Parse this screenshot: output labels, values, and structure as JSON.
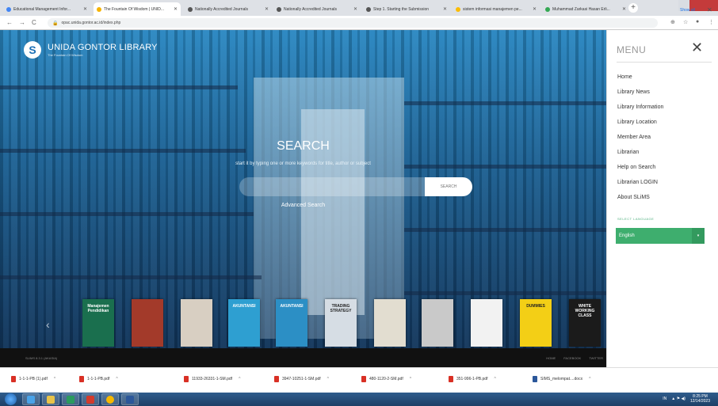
{
  "browser": {
    "tabs": [
      {
        "title": "Educational Management Infor...",
        "fav": "#4285f4"
      },
      {
        "title": "The Fountain Of Wisdom | UNID...",
        "fav": "#f6b300",
        "active": true
      },
      {
        "title": "Nationally Accredited Journals",
        "fav": "#555"
      },
      {
        "title": "Nationally Accredited Journals",
        "fav": "#555"
      },
      {
        "title": "Step 1. Starting the Submission",
        "fav": "#555"
      },
      {
        "title": "sistem informasi manajemen pe...",
        "fav": "#fbbc05"
      },
      {
        "title": "Muhammad Zarkasi Hasan Erli...",
        "fav": "#34a853"
      }
    ],
    "url": "opac.unida.gontor.ac.id/index.php"
  },
  "site": {
    "name": "UNIDA GONTOR LIBRARY",
    "tagline": "The Fountain Of Wisdom",
    "search_title": "SEARCH",
    "search_hint": "start it by typing one or more keywords for title, author or subject",
    "search_placeholder": "",
    "search_button": "SEARCH",
    "advanced_search": "Advanced Search",
    "footer_left": "SLIMS 8.3.1 (AKASIA)",
    "footer_links": [
      "HOME",
      "FACEBOOK",
      "TWITTER"
    ]
  },
  "books": [
    {
      "label": "Manajemen Pendidikan",
      "color": "#1a6f4e"
    },
    {
      "label": "",
      "color": "#a33a2a"
    },
    {
      "label": "",
      "color": "#d8cfc2"
    },
    {
      "label": "AKUNTANSI",
      "color": "#2e9fd1"
    },
    {
      "label": "AKUNTANSI",
      "color": "#2c8fc5"
    },
    {
      "label": "TRADING STRATEGY",
      "color": "#d6dde4"
    },
    {
      "label": "",
      "color": "#e2ddd0"
    },
    {
      "label": "",
      "color": "#c9c9c9"
    },
    {
      "label": "",
      "color": "#f2f2f2"
    },
    {
      "label": "DUMMIES",
      "color": "#f3cf16"
    },
    {
      "label": "WHITE WORKING CLASS",
      "color": "#1b1b1b"
    },
    {
      "label": "",
      "color": "#e9e1c4"
    }
  ],
  "menu": {
    "title": "MENU",
    "items": [
      "Home",
      "Library News",
      "Library Information",
      "Library Location",
      "Member Area",
      "Librarian",
      "Help on Search",
      "Librarian LOGIN",
      "About SLiMS"
    ],
    "lang_label": "SELECT LANGUAGE",
    "lang_value": "English"
  },
  "downloads": [
    {
      "name": "1-1-1-PB (1).pdf",
      "type": "pdf"
    },
    {
      "name": "1-1-1-PB.pdf",
      "type": "pdf"
    },
    {
      "name": "11933-26331-1-SM.pdf",
      "type": "pdf"
    },
    {
      "name": "3947-10251-1-SM.pdf",
      "type": "pdf"
    },
    {
      "name": "480-1120-2-SM.pdf",
      "type": "pdf"
    },
    {
      "name": "351-996-1-PB.pdf",
      "type": "pdf"
    },
    {
      "name": "SIMS_melompat....docx",
      "type": "docx"
    }
  ],
  "download_show_all": "Show all",
  "taskbar": {
    "lang": "IN",
    "time": "8:25 PM",
    "date": "12/14/2023"
  }
}
